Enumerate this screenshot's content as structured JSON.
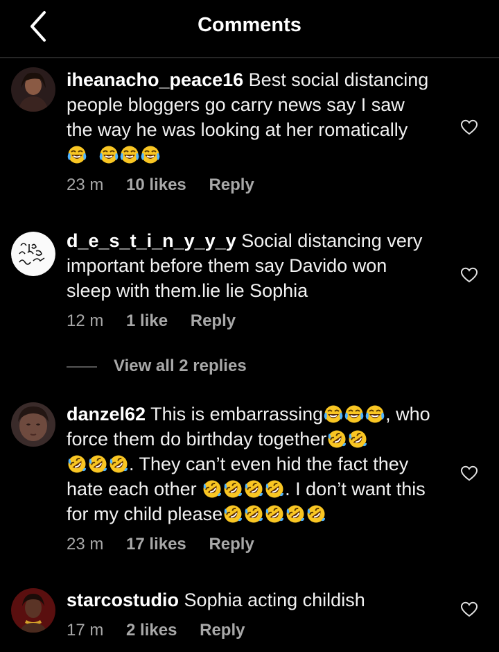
{
  "header": {
    "title": "Comments",
    "back_icon": "chevron-left-icon"
  },
  "comments": [
    {
      "username": "iheanacho_peace16",
      "text_segments": [
        "Best social distancing people bloggers go carry news say I saw the way he was looking at her romatically",
        ""
      ],
      "emojis": [
        "laughing-emoji",
        "laughing-emoji",
        "laughing-emoji",
        "laughing-emoji"
      ],
      "time": "23 m",
      "likes": "10 likes",
      "reply": "Reply"
    },
    {
      "username": "d_e_s_t_i_n_y_y_y",
      "text": "Social distancing very important before them say Davido won sleep with them.lie lie Sophia",
      "time": "12 m",
      "likes": "1 like",
      "reply": "Reply",
      "view_replies": "View all 2 replies"
    },
    {
      "username": "danzel62",
      "text_1": "This is embarrassing",
      "text_2": ", who force them do birthday together",
      "text_3": ". They can’t even hid the fact they hate each other ",
      "text_4": ". I don’t want this for my child please",
      "time": "23 m",
      "likes": "17 likes",
      "reply": "Reply"
    },
    {
      "username": "starcostudio",
      "text": "Sophia acting childish",
      "time": "17 m",
      "likes": "2 likes",
      "reply": "Reply"
    }
  ],
  "colors": {
    "background": "#000000",
    "text": "#f5f5f5",
    "meta": "#a8a8a8",
    "emoji_yellow": "#f9c623"
  }
}
